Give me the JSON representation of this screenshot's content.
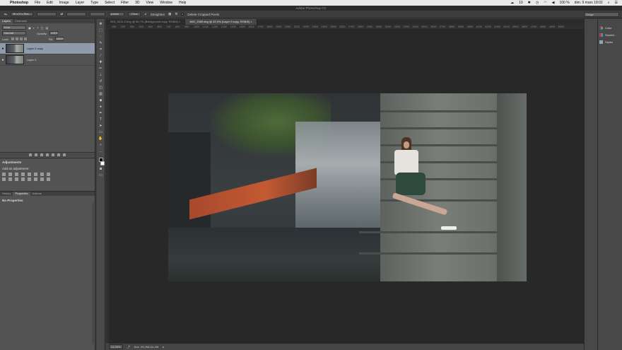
{
  "menubar": {
    "app": "Photoshop",
    "items": [
      "File",
      "Edit",
      "Image",
      "Layer",
      "Type",
      "Select",
      "Filter",
      "3D",
      "View",
      "Window",
      "Help"
    ],
    "status": {
      "badge_count": "10",
      "battery": "100 %",
      "datetime": "dim. 9 mars 18:02"
    }
  },
  "titlebar": {
    "title": "Adobe Photoshop CC"
  },
  "options": {
    "ratio": "W x H x Res...",
    "units": "px/cm",
    "clear_label": "Clear",
    "straighten_label": "Straighten",
    "delete_cropped_label": "Delete Cropped Pixels",
    "workspace": "Serge"
  },
  "layers_panel": {
    "tabs": [
      "Layers",
      "Channels"
    ],
    "kind": "Kind",
    "blend": "Normal",
    "opacity_label": "Opacity:",
    "opacity_value": "100%",
    "lock_label": "Lock:",
    "fill_label": "Fill:",
    "fill_value": "100%",
    "layers": [
      {
        "name": "Layer 0 copy",
        "selected": true
      },
      {
        "name": "Layer 0",
        "selected": false
      }
    ]
  },
  "adjustments_panel": {
    "title": "Adjustments",
    "subtitle": "Add an adjustment"
  },
  "properties_panel": {
    "tabs": [
      "History",
      "Properties",
      "Actions"
    ],
    "content": "No Properties"
  },
  "doc_tabs": [
    {
      "label": "IMG_0211-2.dng @ 66,7% (Background copy, RGB/8) ×",
      "active": false
    },
    {
      "label": "IMG_2389.dng @ 33,3% (Layer 0 copy, RGB/8) ×",
      "active": true
    }
  ],
  "ruler": {
    "ticks": [
      "100",
      "200",
      "300",
      "400",
      "500",
      "600",
      "700",
      "800",
      "900",
      "1000",
      "1100",
      "1200",
      "1300",
      "1400",
      "1500",
      "1600",
      "1700",
      "1800",
      "1900",
      "2000",
      "2100",
      "2200",
      "2300",
      "2400",
      "2500",
      "2600",
      "2700",
      "2800",
      "2900",
      "3000",
      "3100",
      "3200",
      "3300",
      "3400",
      "3500",
      "3600",
      "3700",
      "3800",
      "3900",
      "4000",
      "4100",
      "4200",
      "4300",
      "4400",
      "4500",
      "4600",
      "4700",
      "4800",
      "4900",
      "5000"
    ]
  },
  "statusbar": {
    "zoom": "33,33%",
    "doc_info": "Doc: 29,2M/114,2M"
  },
  "right_dock": {
    "items": [
      "Color",
      "Swatch...",
      "Styles"
    ]
  },
  "colors": {
    "selected_layer": "#8f9bab",
    "canvas_bg": "#282828",
    "panel_bg": "#535353"
  }
}
